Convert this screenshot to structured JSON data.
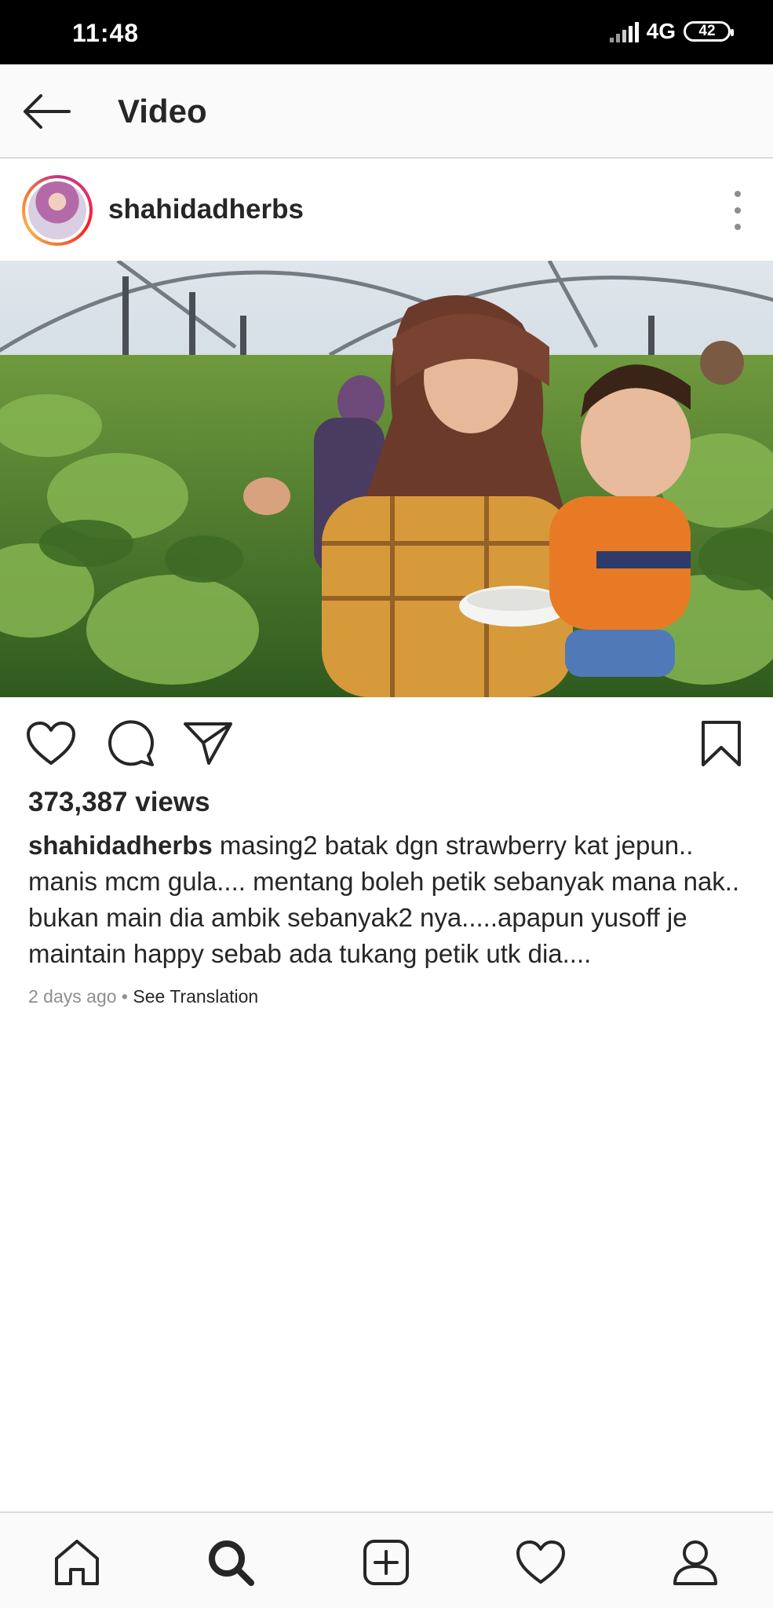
{
  "status_bar": {
    "time": "11:48",
    "network": "4G",
    "battery": "42"
  },
  "header": {
    "title": "Video",
    "back_icon": "arrow-left-icon"
  },
  "post": {
    "username": "shahidadherbs",
    "more_icon": "more-vertical-icon",
    "views": "373,387 views",
    "caption_user": "shahidadherbs",
    "caption_text": "masing2 batak dgn strawberry kat jepun.. manis mcm gula.... mentang boleh petik sebanyak mana nak.. bukan main dia ambik sebanyak2 nya.....apapun yusoff je maintain happy sebab ada tukang petik utk dia....",
    "time_ago": "2 days ago",
    "separator": " • ",
    "see_translation": "See Translation"
  },
  "actions": {
    "like_icon": "heart-icon",
    "comment_icon": "comment-icon",
    "share_icon": "send-icon",
    "save_icon": "bookmark-icon"
  },
  "bottom_nav": {
    "items": [
      "home-icon",
      "search-icon",
      "add-post-icon",
      "activity-heart-icon",
      "profile-icon"
    ],
    "active": "search-icon"
  }
}
